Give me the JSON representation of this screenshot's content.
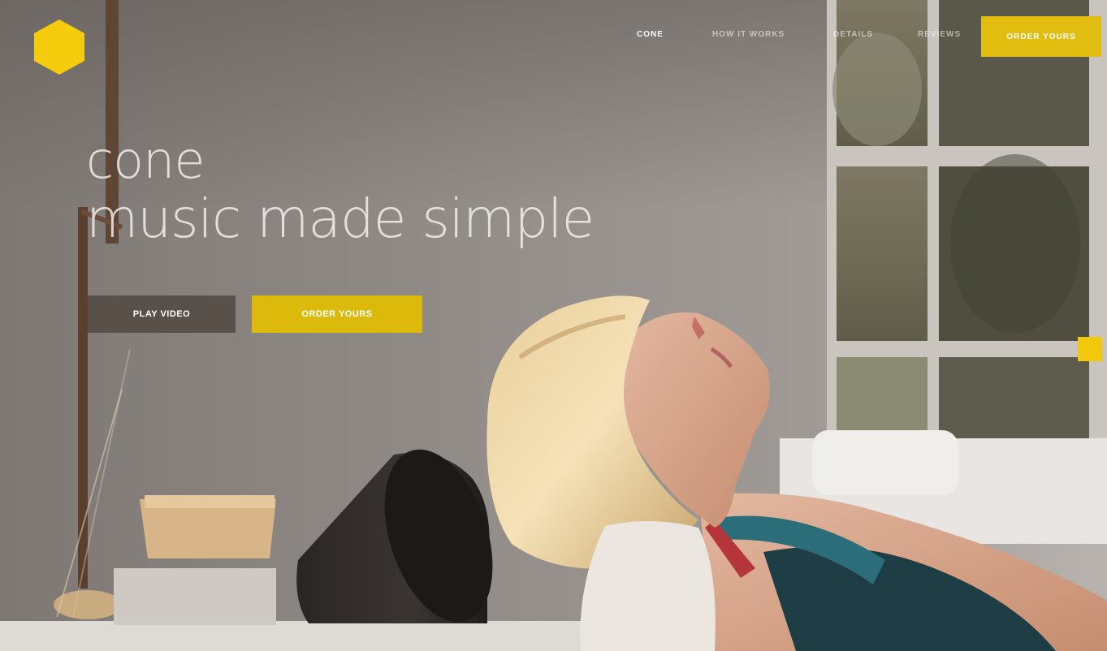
{
  "nav": {
    "items": [
      {
        "label": "CONE",
        "active": true
      },
      {
        "label": "HOW IT WORKS",
        "active": false
      },
      {
        "label": "DETAILS",
        "active": false
      },
      {
        "label": "REVIEWS",
        "active": false
      }
    ],
    "cta_label": "ORDER YOURS"
  },
  "hero": {
    "title": "cone",
    "subtitle": "music made simple",
    "play_label": "PLAY VIDEO",
    "order_label": "ORDER YOURS"
  },
  "colors": {
    "accent": "#e1bd10",
    "play_button": "#5a504a",
    "background": "#8e8985"
  },
  "icons": {
    "logo": "hexagon-logo-icon",
    "side_indicator": "yellow-square-indicator"
  }
}
